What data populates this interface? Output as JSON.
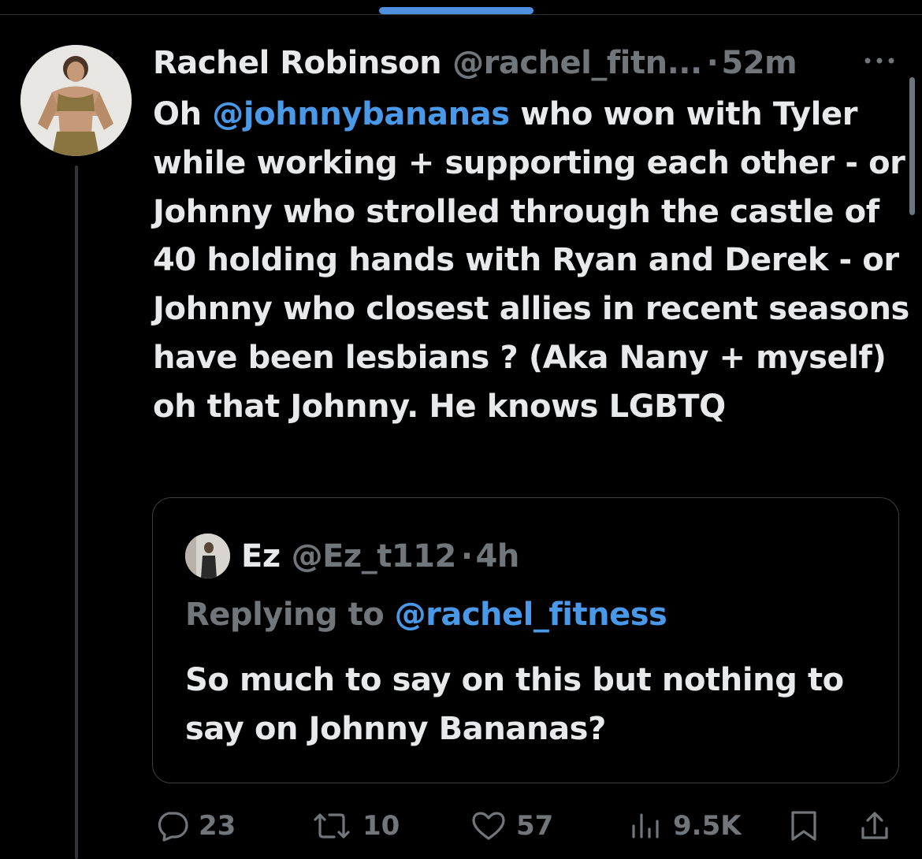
{
  "tweet": {
    "author_name": "Rachel Robinson",
    "author_handle": "@rachel_fitn...",
    "separator": "·",
    "time": "52m",
    "text_parts": {
      "p1": "Oh ",
      "mention": "@johnnybananas",
      "p2": " who won with Tyler while working + supporting each other - or Johnny who strolled through the castle of 40 holding hands with Ryan and Derek - or Johnny who closest allies in recent seasons have been lesbians ? (Aka Nany + myself) oh that Johnny. He knows LGBTQ"
    }
  },
  "quote": {
    "author_name": "Ez",
    "author_handle": "@Ez_t112",
    "separator": "·",
    "time": "4h",
    "replying_label": "Replying to ",
    "replying_handle": "@rachel_fitness",
    "text": "So much to say on this but nothing to say on Johnny Bananas?"
  },
  "actions": {
    "replies": "23",
    "reposts": "10",
    "likes": "57",
    "views": "9.5K"
  },
  "icons": {
    "more": "more-horizontal-icon",
    "reply": "reply-bubble-icon",
    "repost": "repost-arrows-icon",
    "like": "heart-icon",
    "views": "bar-chart-icon",
    "bookmark": "bookmark-icon",
    "share": "share-upload-icon"
  },
  "colors": {
    "background": "#000000",
    "text": "#e7e9ea",
    "secondary": "#71767b",
    "link": "#4a99e9",
    "accent_indicator": "#4f8fe0"
  }
}
